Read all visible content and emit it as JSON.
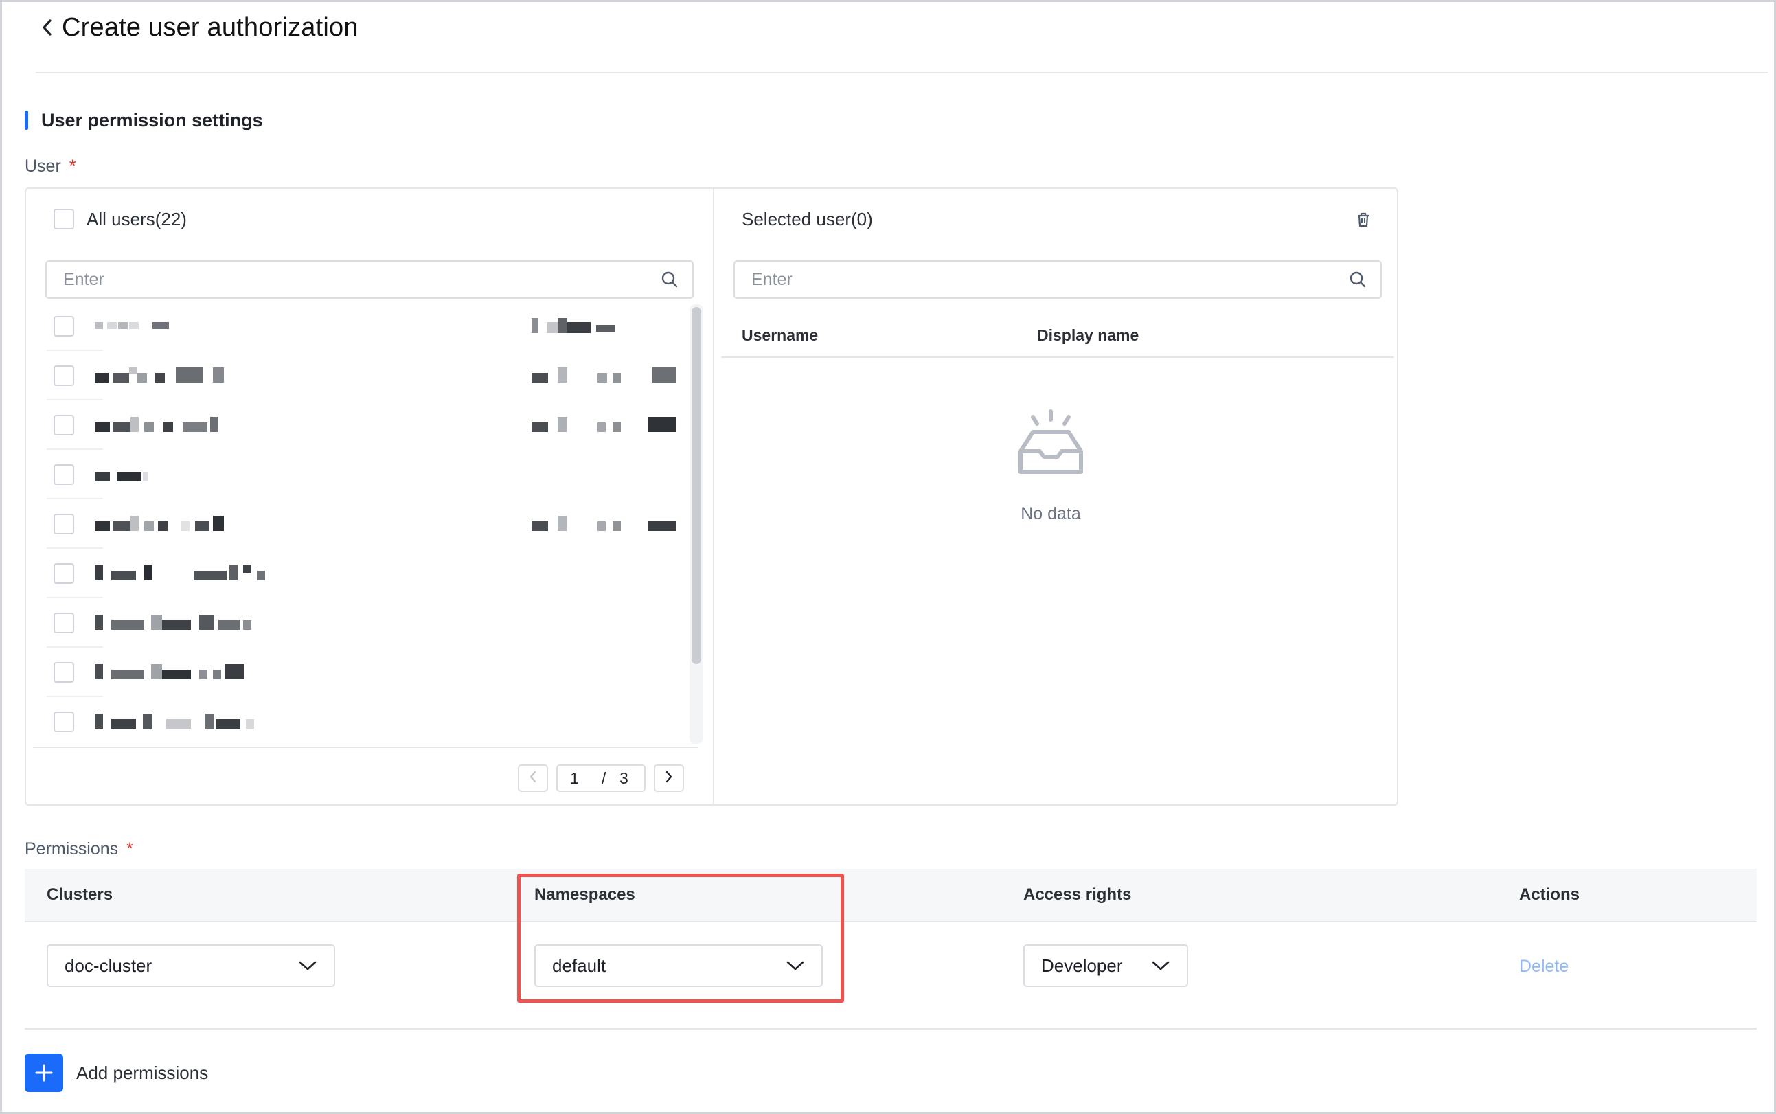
{
  "page": {
    "title": "Create user authorization"
  },
  "section": {
    "title": "User permission settings"
  },
  "user_field": {
    "label": "User",
    "required_mark": "*",
    "all_users_label": "All users(22)",
    "search_placeholder": "Enter",
    "pagination": {
      "current": "1",
      "separator": "/",
      "total": "3"
    },
    "rows_obscured": true
  },
  "selected_panel": {
    "title": "Selected user(0)",
    "search_placeholder": "Enter",
    "columns": [
      "Username",
      "Display name"
    ],
    "empty_text": "No data"
  },
  "permissions": {
    "label": "Permissions",
    "required_mark": "*",
    "columns": [
      "Clusters",
      "Namespaces",
      "Access rights",
      "Actions"
    ],
    "row": {
      "cluster": "doc-cluster",
      "namespace": "default",
      "access": "Developer",
      "action": "Delete"
    },
    "highlighted_column": "Namespaces"
  },
  "add_permissions": {
    "label": "Add permissions"
  },
  "colors": {
    "accent": "#1a6bfa",
    "highlight": "#ef5350",
    "required": "#e5332b",
    "link_disabled": "#8fb9f9"
  },
  "icons": [
    "back-chevron-icon",
    "search-icon",
    "trash-icon",
    "inbox-empty-icon",
    "chevron-down-icon",
    "plus-icon",
    "chevron-left-icon",
    "chevron-right-icon"
  ]
}
